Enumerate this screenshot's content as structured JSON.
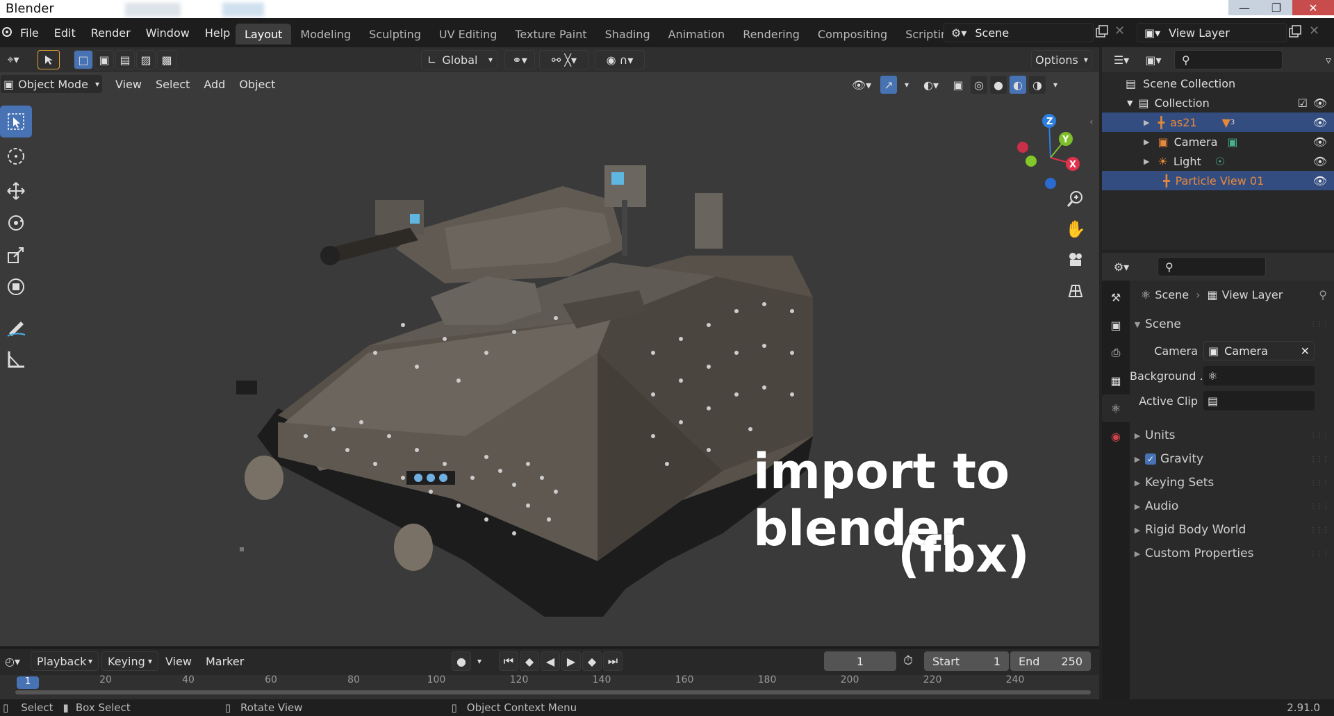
{
  "window": {
    "title": "Blender"
  },
  "menu": [
    "File",
    "Edit",
    "Render",
    "Window",
    "Help"
  ],
  "workspaces": [
    "Layout",
    "Modeling",
    "Sculpting",
    "UV Editing",
    "Texture Paint",
    "Shading",
    "Animation",
    "Rendering",
    "Compositing",
    "Scripting"
  ],
  "scene_field": "Scene",
  "view_layer_field": "View Layer",
  "tool_header": {
    "orientation": "Global",
    "options": "Options"
  },
  "viewport_header": {
    "mode": "Object Mode",
    "menus": [
      "View",
      "Select",
      "Add",
      "Object"
    ]
  },
  "gizmo": {
    "z": "Z",
    "y": "Y",
    "x": "X"
  },
  "overlay": {
    "line1": "import to blender",
    "line2": "(fbx)"
  },
  "timeline": {
    "menus": [
      "Playback",
      "Keying",
      "View",
      "Marker"
    ],
    "current_frame": "1",
    "start_label": "Start",
    "start": "1",
    "end_label": "End",
    "end": "250",
    "ticks": [
      "1",
      "20",
      "40",
      "60",
      "80",
      "100",
      "120",
      "140",
      "160",
      "180",
      "200",
      "220",
      "240"
    ]
  },
  "status": {
    "select": "Select",
    "box_select": "Box Select",
    "rotate_view": "Rotate View",
    "context_menu": "Object Context Menu",
    "version": "2.91.0"
  },
  "outliner": {
    "scene_collection": "Scene Collection",
    "collection": "Collection",
    "items": [
      {
        "name": "as21",
        "badge": "3"
      },
      {
        "name": "Camera"
      },
      {
        "name": "Light"
      },
      {
        "name": "Particle View 01"
      }
    ]
  },
  "properties": {
    "breadcrumb_scene": "Scene",
    "breadcrumb_view_layer": "View Layer",
    "panel_scene": "Scene",
    "camera_label": "Camera",
    "camera_value": "Camera",
    "background_label": "Background ...",
    "active_clip_label": "Active Clip",
    "sections": [
      "Units",
      "Gravity",
      "Keying Sets",
      "Audio",
      "Rigid Body World",
      "Custom Properties"
    ]
  },
  "colors": {
    "accent": "#4772b3",
    "selected_row": "#334d80",
    "orange_text": "#e8893a"
  }
}
